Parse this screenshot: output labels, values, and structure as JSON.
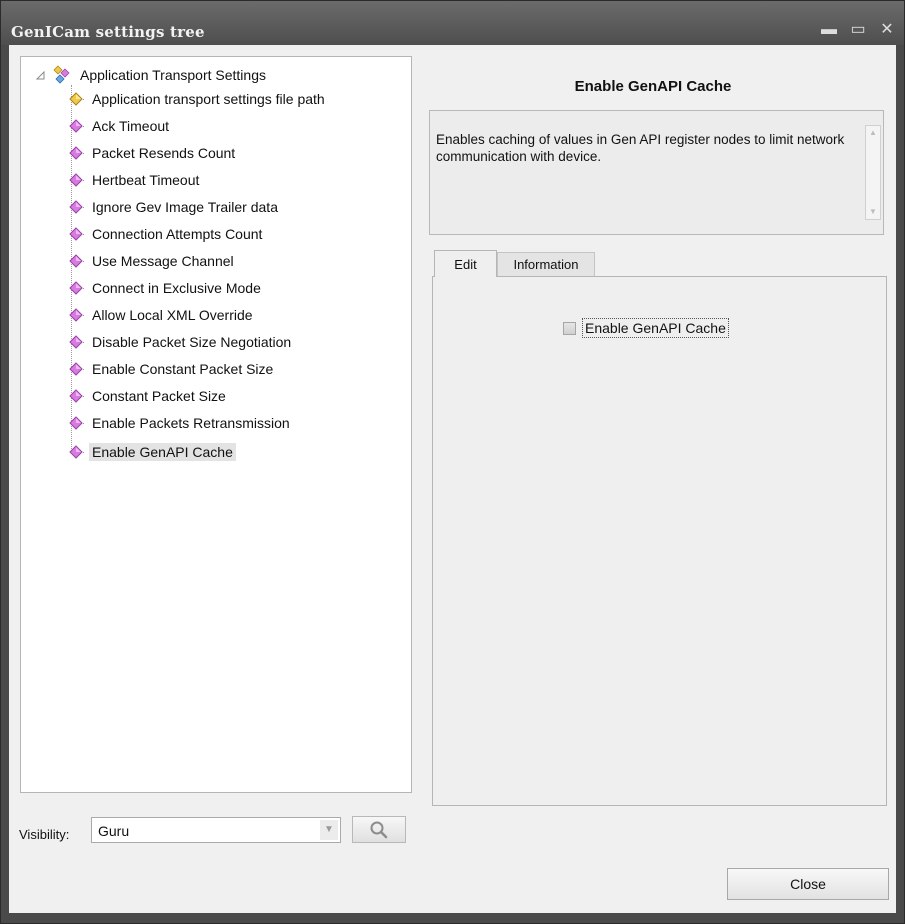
{
  "window": {
    "title": "GenICam settings tree",
    "controls": {
      "minimize": "▬",
      "maximize": "▭",
      "close": "✕"
    }
  },
  "tree": {
    "root": {
      "label": "Application Transport Settings",
      "icon": "settings-group-icon"
    },
    "items": [
      {
        "label": "Application transport settings file path",
        "icon": "yellow-diamond-icon",
        "color": "#e8c24a"
      },
      {
        "label": "Ack Timeout",
        "icon": "pink-diamond-icon",
        "color": "#d77be0"
      },
      {
        "label": "Packet Resends Count",
        "icon": "pink-diamond-icon",
        "color": "#d77be0"
      },
      {
        "label": "Hertbeat Timeout",
        "icon": "pink-diamond-icon",
        "color": "#d77be0"
      },
      {
        "label": "Ignore Gev Image Trailer data",
        "icon": "pink-diamond-icon",
        "color": "#d77be0"
      },
      {
        "label": "Connection Attempts Count",
        "icon": "pink-diamond-icon",
        "color": "#d77be0"
      },
      {
        "label": "Use Message Channel",
        "icon": "pink-diamond-icon",
        "color": "#d77be0"
      },
      {
        "label": "Connect in Exclusive Mode",
        "icon": "pink-diamond-icon",
        "color": "#d77be0"
      },
      {
        "label": "Allow Local XML Override",
        "icon": "pink-diamond-icon",
        "color": "#d77be0"
      },
      {
        "label": "Disable Packet Size Negotiation",
        "icon": "pink-diamond-icon",
        "color": "#d77be0"
      },
      {
        "label": "Enable Constant Packet Size",
        "icon": "pink-diamond-icon",
        "color": "#d77be0"
      },
      {
        "label": "Constant Packet Size",
        "icon": "pink-diamond-icon",
        "color": "#d77be0"
      },
      {
        "label": "Enable Packets Retransmission",
        "icon": "pink-diamond-icon",
        "color": "#d77be0"
      },
      {
        "label": "Enable GenAPI Cache",
        "icon": "pink-diamond-icon",
        "color": "#d77be0",
        "selected": true
      }
    ]
  },
  "visibility": {
    "label": "Visibility:",
    "value": "Guru"
  },
  "details": {
    "title": "Enable GenAPI Cache",
    "description": "Enables caching of values in Gen API register nodes to limit network communication with device."
  },
  "tabs": [
    {
      "label": "Edit",
      "active": true
    },
    {
      "label": "Information",
      "active": false
    }
  ],
  "edit": {
    "checkbox_label": "Enable GenAPI Cache",
    "checked": false
  },
  "footer": {
    "close_label": "Close"
  }
}
